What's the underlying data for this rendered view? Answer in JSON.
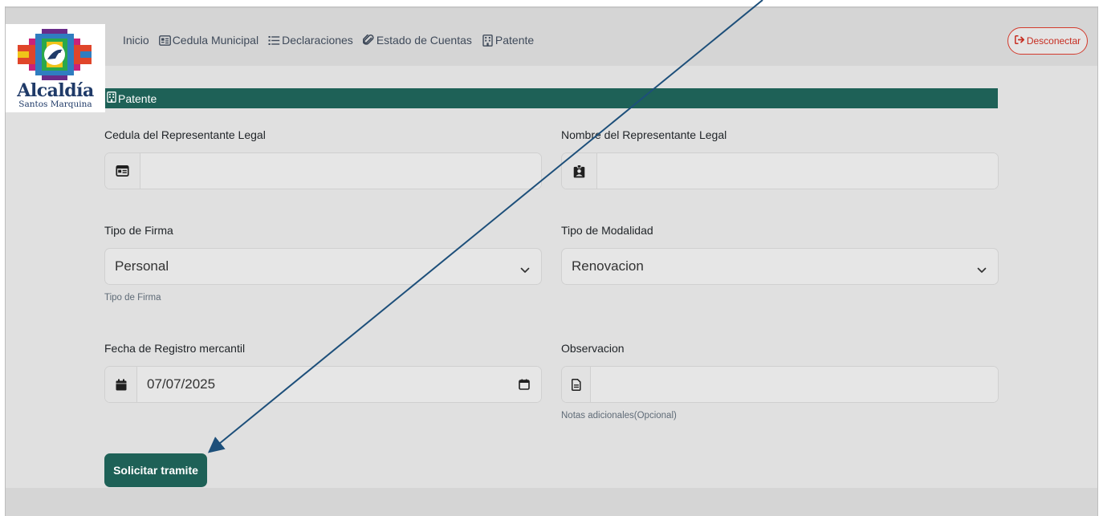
{
  "brand": {
    "title": "Alcaldía",
    "subtitle": "Santos Marquina"
  },
  "nav": {
    "items": [
      {
        "label": "Inicio",
        "icon": ""
      },
      {
        "label": "Cedula Municipal",
        "icon": "id-card-icon"
      },
      {
        "label": "Declaraciones",
        "icon": "list-icon"
      },
      {
        "label": "Estado de Cuentas",
        "icon": "paperclip-icon"
      },
      {
        "label": "Patente",
        "icon": "building-icon"
      }
    ],
    "logout_label": "Desconectar"
  },
  "section": {
    "title": "Patente"
  },
  "form": {
    "cedula": {
      "label": "Cedula del Representante Legal",
      "value": ""
    },
    "nombre": {
      "label": "Nombre del Representante Legal",
      "value": ""
    },
    "tipo_firma": {
      "label": "Tipo de Firma",
      "value": "Personal",
      "help": "Tipo de Firma"
    },
    "tipo_modalidad": {
      "label": "Tipo de Modalidad",
      "value": "Renovacion"
    },
    "fecha_registro": {
      "label": "Fecha de Registro mercantil",
      "value": "07/07/2025"
    },
    "observacion": {
      "label": "Observacion",
      "value": "",
      "help": "Notas adicionales(Opcional)"
    },
    "submit_label": "Solicitar tramite"
  },
  "colors": {
    "primary": "#1e6157",
    "danger": "#d33a2c",
    "arrow": "#1d4f7a"
  }
}
